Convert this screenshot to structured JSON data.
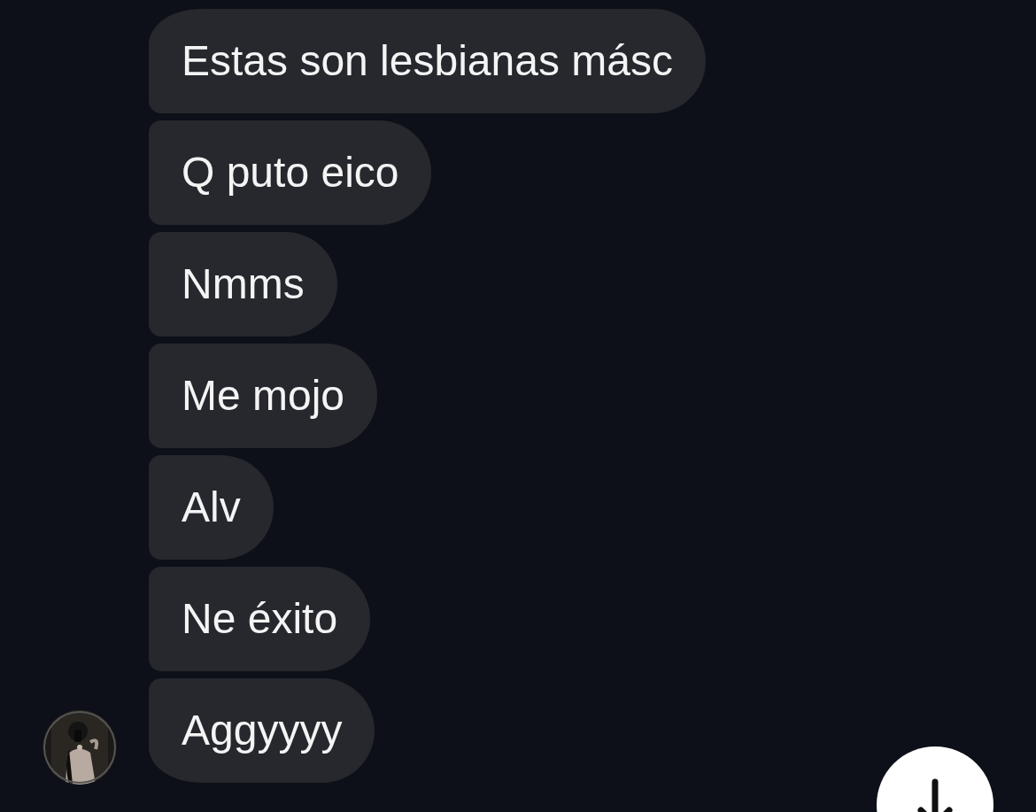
{
  "messages": [
    {
      "text": "Estas son lesbianas másc"
    },
    {
      "text": "Q puto eico"
    },
    {
      "text": "Nmms"
    },
    {
      "text": "Me mojo"
    },
    {
      "text": "Alv"
    },
    {
      "text": "Ne éxito"
    },
    {
      "text": "Aggyyyy"
    }
  ]
}
